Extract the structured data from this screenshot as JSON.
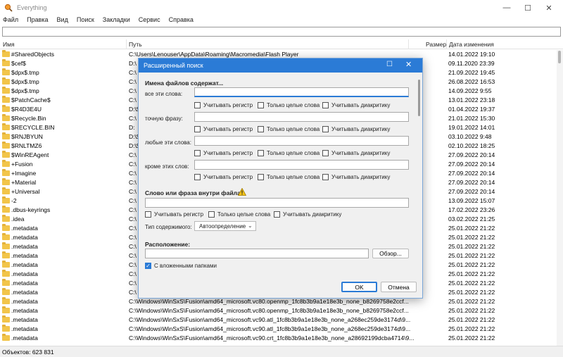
{
  "window": {
    "title": "Everything",
    "minimize_icon": "minimize-icon",
    "maximize_icon": "maximize-icon",
    "close_icon": "close-icon"
  },
  "menu": [
    "Файл",
    "Правка",
    "Вид",
    "Поиск",
    "Закладки",
    "Сервис",
    "Справка"
  ],
  "search": {
    "value": "",
    "placeholder": ""
  },
  "columns": {
    "name": "Имя",
    "path": "Путь",
    "size": "Размер",
    "date": "Дата изменения"
  },
  "rows": [
    {
      "name": "#SharedObjects",
      "path": "C:\\Users\\Lenouser\\AppData\\Roaming\\Macromedia\\Flash Player",
      "date": "14.01.2022 19:10"
    },
    {
      "name": "$cef$",
      "path": "D:\\",
      "date": "09.11.2020 23:39"
    },
    {
      "name": "$dpx$.tmp",
      "path": "C:\\",
      "date": "21.09.2022 19:45"
    },
    {
      "name": "$dpx$.tmp",
      "path": "C:\\",
      "date": "26.08.2022 16:53"
    },
    {
      "name": "$dpx$.tmp",
      "path": "C:\\",
      "date": "14.09.2022 9:55"
    },
    {
      "name": "$PatchCache$",
      "path": "C:\\",
      "date": "13.01.2022 23:18"
    },
    {
      "name": "$R4D3E4U",
      "path": "D:\\$",
      "date": "01.04.2022 19:37"
    },
    {
      "name": "$Recycle.Bin",
      "path": "C:\\",
      "date": "21.01.2022 15:30"
    },
    {
      "name": "$RECYCLE.BIN",
      "path": "D:",
      "date": "19.01.2022 14:01"
    },
    {
      "name": "$RNJBYUN",
      "path": "D:\\$",
      "date": "03.10.2022 9:48"
    },
    {
      "name": "$RNLTMZ6",
      "path": "D:\\$",
      "date": "02.10.2022 18:25"
    },
    {
      "name": "$WinREAgent",
      "path": "C:\\",
      "date": "27.09.2022 20:14"
    },
    {
      "name": "+Fusion",
      "path": "C:\\",
      "date": "27.09.2022 20:14"
    },
    {
      "name": "+Imagine",
      "path": "C:\\",
      "date": "27.09.2022 20:14"
    },
    {
      "name": "+Material",
      "path": "C:\\",
      "date": "27.09.2022 20:14"
    },
    {
      "name": "+Universal",
      "path": "C:\\",
      "date": "27.09.2022 20:14"
    },
    {
      "name": "-2",
      "path": "C:\\",
      "date": "13.09.2022 15:07"
    },
    {
      "name": ".dbus-keyrings",
      "path": "C:\\",
      "date": "17.02.2022 23:26"
    },
    {
      "name": ".idea",
      "path": "C:\\",
      "date": "03.02.2022 21:25"
    },
    {
      "name": ".metadata",
      "path": "C:\\",
      "date": "25.01.2022 21:22"
    },
    {
      "name": ".metadata",
      "path": "C:\\",
      "date": "25.01.2022 21:22"
    },
    {
      "name": ".metadata",
      "path": "C:\\",
      "date": "25.01.2022 21:22"
    },
    {
      "name": ".metadata",
      "path": "C:\\",
      "date": "25.01.2022 21:22"
    },
    {
      "name": ".metadata",
      "path": "C:\\",
      "date": "25.01.2022 21:22"
    },
    {
      "name": ".metadata",
      "path": "C:\\",
      "date": "25.01.2022 21:22"
    },
    {
      "name": ".metadata",
      "path": "C:\\",
      "date": "25.01.2022 21:22"
    },
    {
      "name": ".metadata",
      "path": "C:\\",
      "date": "25.01.2022 21:22"
    },
    {
      "name": ".metadata",
      "path": "C:\\Windows\\WinSxS\\Fusion\\amd64_microsoft.vc80.openmp_1fc8b3b9a1e18e3b_none_b8269758e2ccf...",
      "date": "25.01.2022 21:22"
    },
    {
      "name": ".metadata",
      "path": "C:\\Windows\\WinSxS\\Fusion\\amd64_microsoft.vc80.openmp_1fc8b3b9a1e18e3b_none_b8269758e2ccf...",
      "date": "25.01.2022 21:22"
    },
    {
      "name": ".metadata",
      "path": "C:\\Windows\\WinSxS\\Fusion\\amd64_microsoft.vc90.atl_1fc8b3b9a1e18e3b_none_a268ec259de3174d\\9...",
      "date": "25.01.2022 21:22"
    },
    {
      "name": ".metadata",
      "path": "C:\\Windows\\WinSxS\\Fusion\\amd64_microsoft.vc90.atl_1fc8b3b9a1e18e3b_none_a268ec259de3174d\\9...",
      "date": "25.01.2022 21:22"
    },
    {
      "name": ".metadata",
      "path": "C:\\Windows\\WinSxS\\Fusion\\amd64_microsoft.vc90.crt_1fc8b3b9a1e18e3b_none_a28692199dcba4714\\9...",
      "date": "25.01.2022 21:22"
    }
  ],
  "status": "Объектов: 623 831",
  "dialog": {
    "title": "Расширенный поиск",
    "section_names": "Имена файлов содержат...",
    "all_words": "все эти слова:",
    "exact_phrase": "точную фразу:",
    "any_words": "любые эти слова:",
    "except_words": "кроме этих слов:",
    "match_case": "Учитывать регистр",
    "whole_words": "Только целые слова",
    "match_diacritics": "Учитывать диакритику",
    "section_content": "Слово или фраза внутри файла:",
    "content_type_label": "Тип содержимого:",
    "content_type_value": "Автоопределение",
    "section_location": "Расположение:",
    "browse": "Обзор...",
    "subfolders": "С вложенными папками",
    "ok": "OK",
    "cancel": "Отмена",
    "warning_icon": "warning-icon",
    "accent": "#2b7bd6"
  }
}
